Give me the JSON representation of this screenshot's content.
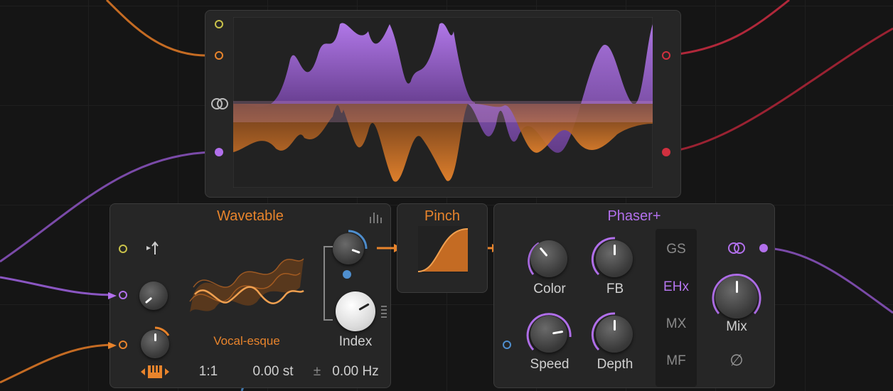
{
  "colors": {
    "orange": "#e8842c",
    "purple": "#b270ec",
    "red": "#d1303f",
    "blue": "#4f8fcf",
    "yellow": "#c9c24a",
    "background": "#151515",
    "panel": "#262626"
  },
  "icons": {
    "stereo": "stereo-link-icon",
    "ascending": "pitch-arrow-icon",
    "keyboard": "keyboard-tracking-icon",
    "bars": "spectrum-bars-icon",
    "phase": "phase-invert-icon"
  },
  "wavetable": {
    "title": "Wavetable",
    "preset": "Vocal-esque",
    "ratio": "1:1",
    "semitones": "0.00 st",
    "plus_minus": "±",
    "hz": "0.00 Hz",
    "index_label": "Index"
  },
  "pinch": {
    "title": "Pinch"
  },
  "phaser": {
    "title": "Phaser+",
    "color_label": "Color",
    "fb_label": "FB",
    "speed_label": "Speed",
    "depth_label": "Depth",
    "mix_label": "Mix",
    "modes": [
      "GS",
      "EHx",
      "MX",
      "MF"
    ],
    "active_mode": "EHx",
    "phase_symbol": "∅"
  }
}
